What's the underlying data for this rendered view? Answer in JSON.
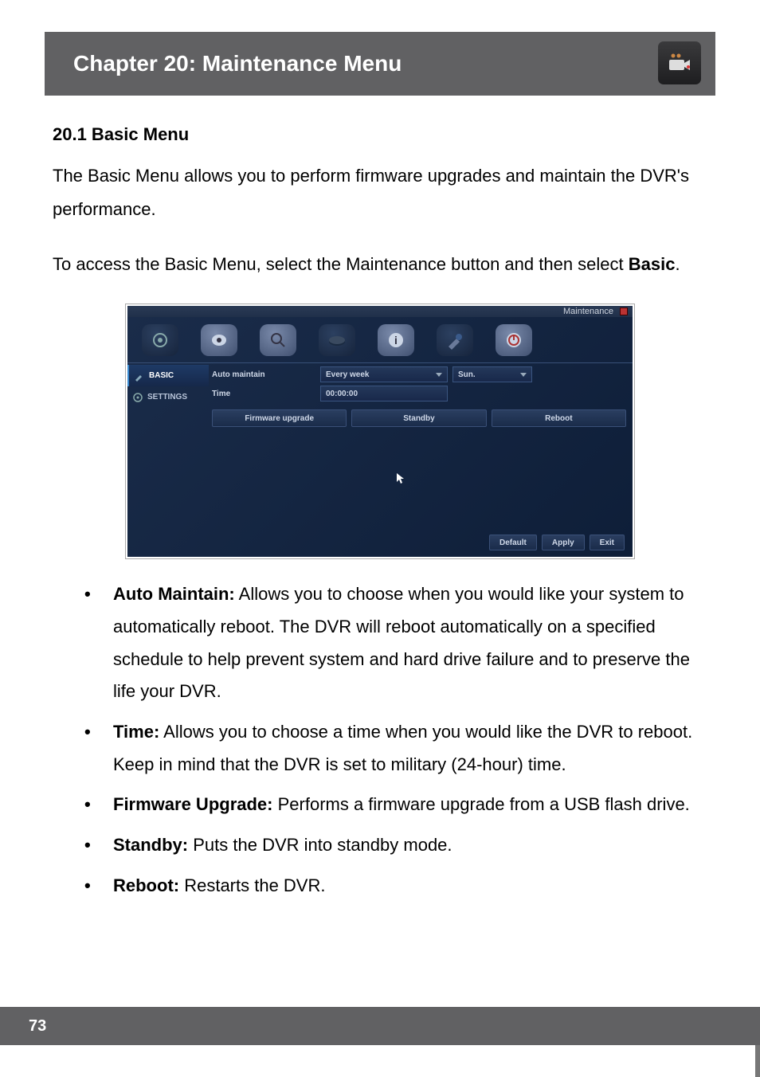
{
  "chapter": {
    "title": "Chapter 20: Maintenance Menu",
    "icon": "camera-icon"
  },
  "section": {
    "heading": "20.1 Basic Menu"
  },
  "paragraphs": {
    "p1": "The Basic Menu allows you to perform firmware upgrades and maintain the DVR's performance.",
    "p2a": "To access the Basic Menu, select the Maintenance button and then select ",
    "p2b": "Basic",
    "p2c": "."
  },
  "screenshot": {
    "topbar": {
      "title": "Maintenance"
    },
    "sidebar": {
      "items": [
        {
          "label": "BASIC",
          "icon": "wrench-icon",
          "active": true
        },
        {
          "label": "SETTINGS",
          "icon": "gear-icon",
          "active": false
        }
      ]
    },
    "form": {
      "rows": [
        {
          "label": "Auto maintain",
          "field1": "Every week",
          "field2": "Sun."
        },
        {
          "label": "Time",
          "field1": "00:00:00",
          "field2": ""
        }
      ]
    },
    "action_buttons": [
      {
        "label": "Firmware upgrade"
      },
      {
        "label": "Standby"
      },
      {
        "label": "Reboot"
      }
    ],
    "footer_buttons": [
      {
        "label": "Default"
      },
      {
        "label": "Apply"
      },
      {
        "label": "Exit"
      }
    ]
  },
  "bullets": [
    {
      "term": "Auto Maintain:",
      "text": " Allows you to choose when you would like your system to automatically reboot. The DVR will reboot automatically on a specified schedule to help prevent system and hard drive failure and to preserve the life your DVR."
    },
    {
      "term": "Time:",
      "text": " Allows you to choose a time when you would like the DVR to reboot. Keep in mind that the DVR is set to military (24-hour) time."
    },
    {
      "term": "Firmware Upgrade:",
      "text": " Performs a firmware upgrade from a USB flash drive."
    },
    {
      "term": "Standby:",
      "text": " Puts the DVR into standby mode."
    },
    {
      "term": "Reboot:",
      "text": " Restarts the DVR."
    }
  ],
  "page_number": "73"
}
